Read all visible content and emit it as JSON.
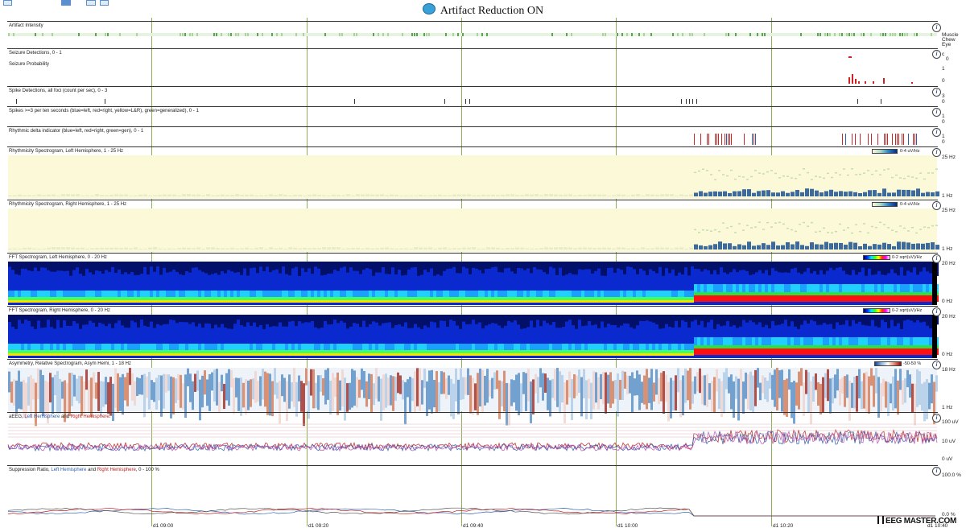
{
  "title": "Artifact Reduction ON",
  "title_icon": "brain-icon",
  "panels": {
    "artifact": {
      "label": "Artifact Intensity",
      "legend": [
        "Muscle",
        "Chew",
        "Eye"
      ]
    },
    "seizure_det": {
      "label": "Seizure Detections, 0 - 1",
      "scale": [
        "c",
        "0"
      ]
    },
    "seizure_prob": {
      "label": "Seizure Probability",
      "scale": [
        "1",
        "0"
      ]
    },
    "spike_det": {
      "label": "Spike Detections, all foci (count per sec), 0 - 3",
      "scale": [
        "3",
        "0"
      ]
    },
    "spikes10": {
      "label": "Spikes >=3 per ten seconds (blue=left, red=right, yellow=L&R), green=generalized),  0 - 1",
      "scale": [
        "1",
        "0"
      ]
    },
    "rhythmic_delta": {
      "label": "Rhythmic delta indicator (blue=left, red=right, green=gen),  0 - 1",
      "scale": [
        "1",
        "0"
      ]
    },
    "rhythm_left": {
      "label": "Rhythmicity Spectrogram, Left Hemisphere, 1 - 25 Hz",
      "scale_hi": "25 Hz",
      "scale_lo": "1 Hz",
      "colorbar": "0-4 uV/Hz"
    },
    "rhythm_right": {
      "label": "Rhythmicity Spectrogram, Right Hemisphere, 1 - 25 Hz",
      "scale_hi": "25 Hz",
      "scale_lo": "1 Hz",
      "colorbar": "0-4 uV/Hz"
    },
    "fft_left": {
      "label": "FFT Spectrogram, Left Hemisphere, 0 - 20 Hz",
      "scale_hi": "20 Hz",
      "scale_lo": "0 Hz",
      "colorbar": "0-2 sqrt(uV)/Hz"
    },
    "fft_right": {
      "label": "FFT Spectrogram, Right Hemisphere, 0 - 20 Hz",
      "scale_hi": "20 Hz",
      "scale_lo": "0 Hz",
      "colorbar": "0-2 sqrt(uV)/Hz"
    },
    "asym": {
      "label": "Asymmetry, Relative Spectrogram, Asym Hemi, 1 - 18 Hz",
      "scale_hi": "18 Hz",
      "scale_lo": "1 Hz",
      "colorbar": "-50-50 %"
    },
    "aeeg": {
      "label_prefix": "aEEG, ",
      "label_left": "Left Hemisphere",
      "label_mid": " and ",
      "label_right": "Right Hemisphere",
      "label_suffix": ".",
      "scale": [
        "100 uV",
        "10 uV",
        "0 uV"
      ]
    },
    "suppression": {
      "label_prefix": "Suppression Ratio, ",
      "label_left": "Left Hemisphere",
      "label_mid": " and ",
      "label_right": "Right Hemisphere",
      "label_suffix": ",  0 - 100 %",
      "scale": [
        "100.0 %",
        "0.0 %"
      ]
    }
  },
  "info_glyph": "i",
  "time_ticks": [
    "d1 09:00",
    "d1 09:20",
    "d1 09:40",
    "d1 10:00",
    "d1 10:20",
    "d1 10:40"
  ],
  "logo": "EEG MASTER.COM",
  "colors": {
    "grid_line": "#8fb05a",
    "left": "#2d5fb0",
    "right": "#c02020",
    "pale_yellow": "#fbf9d8",
    "fft_blue": "#0a2ad0"
  }
}
